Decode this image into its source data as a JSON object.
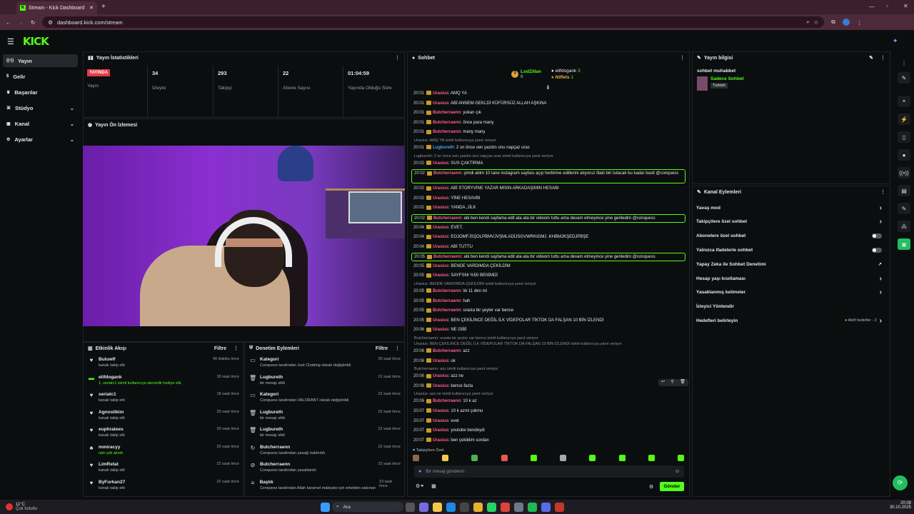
{
  "browser": {
    "tab_title": "Stream - Kick Dashboard",
    "url": "dashboard.kick.com/stream"
  },
  "app": {
    "logo": "KICK"
  },
  "sidebar": {
    "items": [
      {
        "label": "Yayın",
        "icon": "broadcast-icon",
        "active": true
      },
      {
        "label": "Gelir",
        "icon": "dollar-icon"
      },
      {
        "label": "Başarılar",
        "icon": "trophy-icon"
      },
      {
        "label": "Stüdyo",
        "icon": "studio-icon",
        "chev": true
      },
      {
        "label": "Kanal",
        "icon": "channel-icon",
        "chev": true
      },
      {
        "label": "Ayarlar",
        "icon": "gear-icon",
        "chev": true
      }
    ]
  },
  "stats": {
    "title": "Yayın İstatistikleri",
    "live_badge": "YAYINDA",
    "live_label": "Yayın",
    "items": [
      {
        "value": "34",
        "label": "İzleyici"
      },
      {
        "value": "293",
        "label": "Takipçi"
      },
      {
        "value": "22",
        "label": "Abone Sayısı"
      },
      {
        "value": "01:04:59",
        "label": "Yayında Olduğu Süre"
      }
    ]
  },
  "preview": {
    "title": "Yayın Ön İzlemesi"
  },
  "feed": {
    "title": "Etkinlik Akışı",
    "filter": "Filtre",
    "rows": [
      {
        "name": "Buluwlf",
        "sub": "kanalı takip etti",
        "time": "40 dakika önce"
      },
      {
        "name": "elifdogank",
        "sub": "1, seriatc1 isimli kullanıcıya abonelik hediye etti.",
        "time": "18 saat önce"
      },
      {
        "name": "seriatc1",
        "sub": "kanalı takip etti",
        "time": "18 saat önce"
      },
      {
        "name": "Agnostikim",
        "sub": "kanalı takip etti",
        "time": "20 saat önce"
      },
      {
        "name": "euphratees",
        "sub": "kanalı takip etti",
        "time": "20 saat önce"
      },
      {
        "name": "mmiracyy",
        "sub": "nah çok alındı",
        "time": "20 saat önce"
      },
      {
        "name": "LimRetat",
        "sub": "kanalı takip etti",
        "time": "22 saat önce"
      },
      {
        "name": "ByFurkan27",
        "sub": "kanalı takip etti",
        "time": "22 saat önce"
      }
    ]
  },
  "mod": {
    "title": "Denetim Eylemleri",
    "filter": "Filtre",
    "rows": [
      {
        "name": "Kategori",
        "sub": "Conquess tarafından Just Chatting olarak değiştirildi",
        "time": "20 saat önce"
      },
      {
        "name": "Lugbureth",
        "sub": "bir mesajı sildi",
        "time": "21 saat önce"
      },
      {
        "name": "Kategori",
        "sub": "Conquess tarafından VALORANT olarak değiştirildi",
        "time": "22 saat önce"
      },
      {
        "name": "Lugbureth",
        "sub": "bir mesajı sildi",
        "time": "22 saat önce"
      },
      {
        "name": "Lugbureth",
        "sub": "bir mesajı sildi",
        "time": "22 saat önce"
      },
      {
        "name": "Butcherraenn",
        "sub": "Conquess tarafından yasağı kaldırıldı",
        "time": "22 saat önce"
      },
      {
        "name": "Butcherraenn",
        "sub": "Conquess tarafından yasaklandı",
        "time": "22 saat önce"
      },
      {
        "name": "Başlık",
        "sub": "Conquess tarafından Allah karamel makiyato için erkekten sakınan",
        "time": "23 saat önce"
      }
    ]
  },
  "chat": {
    "title": "Sohbet",
    "top": [
      {
        "rank": "1",
        "name": "LodZillan",
        "val": "6"
      },
      {
        "name": "elifdogank",
        "val": "3"
      },
      {
        "name": "Niffels",
        "val": "1"
      }
    ],
    "messages": [
      {
        "t": "20:01",
        "u": "Urasius",
        "m": "AMQ YA"
      },
      {
        "t": "20:01",
        "u": "Urasius",
        "m": "ABİ ANNEM GEKLDİ KÜFÜRSÜZ ALLAH AŞKINA"
      },
      {
        "t": "20:01",
        "u": "Butcherraenn",
        "m": "yukarı çık"
      },
      {
        "t": "20:01",
        "u": "Butcherraenn",
        "m": "önce para many"
      },
      {
        "t": "20:01",
        "u": "Butcherraenn",
        "m": "many many"
      },
      {
        "reply": "Urasius: AMQ YA isimli kullanıcıya yanıt veriyor"
      },
      {
        "t": "20:01",
        "u": "Lugbureth",
        "m": "2 sn önce sen yazdın onu napçaz uras",
        "blue": true
      },
      {
        "reply": "Lugbureth: 2 sn önce sen yazdın onu napçaz uras isimli kullanıcıya yanıt veriyor"
      },
      {
        "t": "20:02",
        "u": "Urasius",
        "m": "SUS ÇAKTIRMA"
      },
      {
        "t": "20:02",
        "u": "Butcherraenn",
        "m": "şimdi abim 10 tane instagram sayfası açıp herbirine editlerini atıyoruz illaki biri tutacak bu kadar basit @conquess",
        "hl": true,
        "two": true
      },
      {
        "t": "20:02",
        "u": "Urasius",
        "m": "ABİ STORYVİNE YAZAR MISIN ARKADAŞIMIN HESABI"
      },
      {
        "t": "20:02",
        "u": "Urasius",
        "m": "YİNE HESAVBI"
      },
      {
        "t": "20:02",
        "u": "Urasius",
        "m": "YANDA ,JİLK"
      },
      {
        "t": "20:02",
        "u": "Butcherraenn",
        "m": "abi ben kendi sayfama edit ata ata bir videom tuttu ama devam etmeyince yine geriledim @conquess",
        "hl": true
      },
      {
        "t": "20:04",
        "u": "Urasius",
        "m": "EVET,"
      },
      {
        "t": "20:04",
        "u": "Urasius",
        "m": "EOJOMF.İSŞOLPBMVJVŞMLADİJSGVWRKIGMJ .KHBMJKŞEDJPBŞE"
      },
      {
        "t": "20:04",
        "u": "Urasius",
        "m": "ABİ TUTTU"
      },
      {
        "t": "20:05",
        "u": "Butcherraenn",
        "m": "abi ben kendi sayfama edit ata ata bir videom tuttu ama devam etmeyince yine geriledim @conquess",
        "hl": true
      },
      {
        "t": "20:05",
        "u": "Urasius",
        "m": "BENDE VARDIMDA ÇEKİLDİM"
      },
      {
        "t": "20:05",
        "u": "Urasius",
        "m": "SAYFSNI %50 BENİMDİ"
      },
      {
        "reply": "Urasius: BENDE VARDIMDA ÇEKİLDİM isimli kullanıcıya yanıt veriyor"
      },
      {
        "t": "20:05",
        "u": "Butcherraenn",
        "m": "lık 11 den mi"
      },
      {
        "t": "20:05",
        "u": "Butcherraenn",
        "m": "hah"
      },
      {
        "t": "20:05",
        "u": "Butcherraenn",
        "m": "urasta bir şeyler var bence"
      },
      {
        "t": "20:05",
        "u": "Urasius",
        "m": "BEN ÇEKİLİNCE DEĞİL İLK VİDEPOLAR TİKTOK DA FALŞAN 10 BİN İZLENDİ"
      },
      {
        "t": "20:06",
        "u": "Urasius",
        "m": "NE GİBİ"
      },
      {
        "reply": "Butcherraenn: urasta bir şeyler var bence isimli kullanıcıya yanıt veriyor"
      },
      {
        "reply": "Urasius: BEN ÇEKİLİNCE DEĞİL İLK VİDEPOLAR TİKTOK DA FALŞAN 10 BİN İZLENDİ isimli kullanıcıya yanıt veriyor"
      },
      {
        "t": "20:06",
        "u": "Butcherraenn",
        "m": "azz"
      },
      {
        "t": "20:06",
        "u": "Urasius",
        "m": "ok"
      },
      {
        "reply": "Butcherraenn: azz isimli kullanıcıya yanıt veriyor"
      },
      {
        "t": "20:06",
        "u": "Urasius",
        "m": "azz ne"
      },
      {
        "t": "20:06",
        "u": "Urasius",
        "m": "bence fazla"
      },
      {
        "reply": "Urasius: azz ne isimli kullanıcıya yanıt veriyor"
      },
      {
        "t": "20:06",
        "u": "Butcherraenn",
        "m": "10 k az"
      },
      {
        "t": "20:07",
        "u": "Urasius",
        "m": "10 k azmi çokmu"
      },
      {
        "t": "20:07",
        "u": "Urasius",
        "m": "evet"
      },
      {
        "t": "20:07",
        "u": "Urasius",
        "m": "youtube bendeydi"
      },
      {
        "t": "20:07",
        "u": "Urasius",
        "m": "ben çekildim sordan"
      }
    ],
    "followers_label": "Takipçilere Özel",
    "input_placeholder": "Bir mesaj gönderin",
    "send": "Gönder"
  },
  "info": {
    "title": "Yayın bilgisi",
    "stream_title": "sohbet muhabbet",
    "category": "Sadece Sohbet",
    "lang": "Turkish"
  },
  "actions": {
    "title": "Kanal Eylemleri",
    "items": [
      {
        "label": "Yavaş mod",
        "type": "arrow"
      },
      {
        "label": "Takipçilere özel sohbet",
        "type": "arrow"
      },
      {
        "label": "Abonelere özel sohbet",
        "type": "toggle"
      },
      {
        "label": "Yalnızca ifadelerle sohbet",
        "type": "toggle"
      },
      {
        "label": "Yapay Zeka ile Sohbet Denetimi",
        "type": "ext"
      },
      {
        "label": "Hesap yaşı kısıtlaması",
        "type": "arrow"
      },
      {
        "label": "Yasaklanmış kelimeler",
        "type": "arrow"
      },
      {
        "label": "İzleyici Yönlendir",
        "type": "none"
      },
      {
        "label": "Hedefleri belirleyin",
        "type": "goal",
        "extra": "Aktif hedefler - 2"
      }
    ]
  },
  "taskbar": {
    "weather": "11°C",
    "weather_sub": "Çok bulutlu",
    "search": "Ara",
    "time": "20:08",
    "date": "30.10.2025"
  },
  "colors": {
    "accent": "#53fc18",
    "user_red": "#ff5d8f",
    "live": "#e23a4a"
  }
}
